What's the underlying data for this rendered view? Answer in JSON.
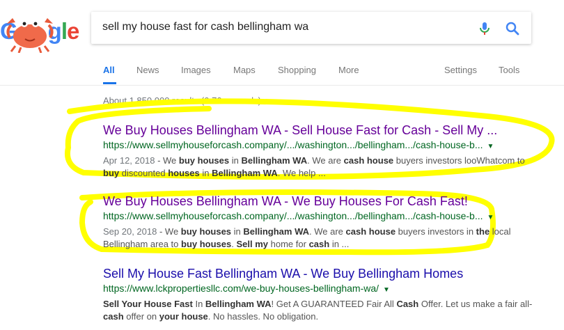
{
  "search": {
    "query": "sell my house fast for cash bellingham wa"
  },
  "logo": {
    "text": "Google"
  },
  "tabs": [
    "All",
    "News",
    "Images",
    "Maps",
    "Shopping",
    "More"
  ],
  "tools": {
    "settings": "Settings",
    "tools": "Tools"
  },
  "stats": "About 1,850,000 results (0.70 seconds)",
  "results": [
    {
      "title": "We Buy Houses Bellingham WA - Sell House Fast for Cash - Sell My ...",
      "url": "https://www.sellmyhouseforcash.company/.../washington.../bellingham.../cash-house-b...",
      "date": "Apr 12, 2018",
      "snippet_parts": [
        {
          "t": " - We ",
          "b": false
        },
        {
          "t": "buy houses",
          "b": true
        },
        {
          "t": " in ",
          "b": false
        },
        {
          "t": "Bellingham WA",
          "b": true
        },
        {
          "t": ". We are ",
          "b": false
        },
        {
          "t": "cash house",
          "b": true
        },
        {
          "t": " buyers investors looWhatcom to ",
          "b": false
        },
        {
          "t": "buy",
          "b": true
        },
        {
          "t": " discounted ",
          "b": false
        },
        {
          "t": "houses",
          "b": true
        },
        {
          "t": " in ",
          "b": false
        },
        {
          "t": "Bellingham WA",
          "b": true
        },
        {
          "t": ". We help ...",
          "b": false
        }
      ]
    },
    {
      "title": "We Buy Houses Bellingham WA - We Buy Houses For Cash Fast!",
      "url": "https://www.sellmyhouseforcash.company/.../washington.../bellingham.../cash-house-b...",
      "date": "Sep 20, 2018",
      "snippet_parts": [
        {
          "t": " - We ",
          "b": false
        },
        {
          "t": "buy houses",
          "b": true
        },
        {
          "t": " in ",
          "b": false
        },
        {
          "t": "Bellingham WA",
          "b": true
        },
        {
          "t": ". We are ",
          "b": false
        },
        {
          "t": "cash house",
          "b": true
        },
        {
          "t": " buyers investors in ",
          "b": false
        },
        {
          "t": "the",
          "b": true
        },
        {
          "t": " local Bellingham area to ",
          "b": false
        },
        {
          "t": "buy houses",
          "b": true
        },
        {
          "t": ". ",
          "b": false
        },
        {
          "t": "Sell my",
          "b": true
        },
        {
          "t": " home for ",
          "b": false
        },
        {
          "t": "cash",
          "b": true
        },
        {
          "t": " in ...",
          "b": false
        }
      ]
    },
    {
      "title": "Sell My House Fast Bellingham WA - We Buy Bellingham Homes",
      "url": "https://www.lckpropertiesllc.com/we-buy-houses-bellingham-wa/",
      "date": "",
      "snippet_parts": [
        {
          "t": "Sell Your House Fast",
          "b": true
        },
        {
          "t": " In ",
          "b": false
        },
        {
          "t": "Bellingham WA",
          "b": true
        },
        {
          "t": "! Get A GUARANTEED Fair All ",
          "b": false
        },
        {
          "t": "Cash",
          "b": true
        },
        {
          "t": " Offer. Let us make a fair all-",
          "b": false
        },
        {
          "t": "cash",
          "b": true
        },
        {
          "t": " offer on ",
          "b": false
        },
        {
          "t": "your house",
          "b": true
        },
        {
          "t": ". No hassles. No obligation.",
          "b": false
        }
      ]
    }
  ],
  "colors": {
    "highlight": "#ffff00",
    "visited": "#660099",
    "link": "#1a0dab",
    "url": "#006621",
    "active_tab": "#1a73e8"
  }
}
